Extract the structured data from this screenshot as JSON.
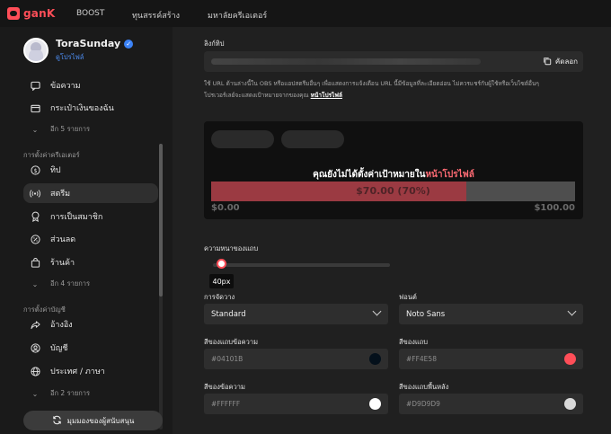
{
  "topnav": {
    "logo_text": "ganK",
    "links": [
      "BOOST",
      "ทุนสรรค์สร้าง",
      "มหาลัยครีเอเตอร์"
    ]
  },
  "sidebar": {
    "profile": {
      "name": "ToraSunday",
      "link": "ดูโปรไฟล์"
    },
    "group1": [
      {
        "label": "ข้อความ",
        "icon": "message-icon"
      },
      {
        "label": "กระเป๋าเงินของฉัน",
        "icon": "wallet-icon"
      },
      {
        "label": "อีก 5 รายการ",
        "icon": "chevron-down-icon"
      }
    ],
    "section_creator": "การตั้งค่าครีเอเตอร์",
    "group2": [
      {
        "label": "ทิป",
        "icon": "dollar-icon"
      },
      {
        "label": "สตรีม",
        "icon": "broadcast-icon",
        "active": true
      },
      {
        "label": "การเป็นสมาชิก",
        "icon": "badge-icon"
      },
      {
        "label": "ส่วนลด",
        "icon": "discount-icon"
      },
      {
        "label": "ร้านค้า",
        "icon": "store-icon"
      },
      {
        "label": "อีก 4 รายการ",
        "icon": "chevron-down-icon"
      }
    ],
    "section_account": "การตั้งค่าบัญชี",
    "group3": [
      {
        "label": "อ้างอิง",
        "icon": "share-icon"
      },
      {
        "label": "บัญชี",
        "icon": "account-icon"
      },
      {
        "label": "ประเทศ / ภาษา",
        "icon": "globe-icon"
      },
      {
        "label": "อีก 2 รายการ",
        "icon": "chevron-down-icon"
      }
    ],
    "bottom_button": "มุมมองของผู้สนับสนุน"
  },
  "main": {
    "link_label": "ลิงก์ทิป",
    "copy_label": "คัดลอก",
    "desc_line1": "ใช้ URL ด้านล่างนี้ใน OBS หรือแอปสตรีมอื่นๆ เพื่อแสดงการแจ้งเตือน URL นี้มีข้อมูลที่ละเอียดอ่อน ไม่ควรแชร์กับผู้ใช้หรือเว็บไซต์อื่นๆ",
    "desc_line2_prefix": "โปรเวอร์เลย์จะแสดงเป้าหมายจากของคุณ",
    "desc_line2_link": "หน้าโปรไฟล์",
    "preview": {
      "goal_text_main": "คุณยังไม่ได้ตั้งค่าเป้าหมายใน",
      "goal_text_pink": "หน้าโปรไฟล์",
      "bar_text": "$70.00 (70%)",
      "progress": 0.7,
      "min_label": "$0.00",
      "max_label": "$100.00"
    },
    "thickness_label": "ความหนาของแถบ",
    "slider_value": "40px",
    "layout_label": "การจัดวาง",
    "layout_value": "Standard",
    "font_label": "ฟอนต์",
    "font_value": "Noto Sans",
    "text_outline_label": "สีของแถบข้อความ",
    "text_outline_value": "#04101B",
    "bar_color_label": "สีของแถบ",
    "bar_color_value": "#FF4E58",
    "text_color_label": "สีของข้อความ",
    "text_color_value": "#FFFFFF",
    "bar_bg_label": "สีของแถบพื้นหลัง",
    "bar_bg_value": "#D9D9D9"
  },
  "colors": {
    "accent": "#FF4E58",
    "link_blue": "#4E8FF5",
    "swatch_text_outline": "#04101B",
    "swatch_bar": "#FF4E58",
    "swatch_text": "#FFFFFF",
    "swatch_bar_bg": "#D9D9D9"
  }
}
